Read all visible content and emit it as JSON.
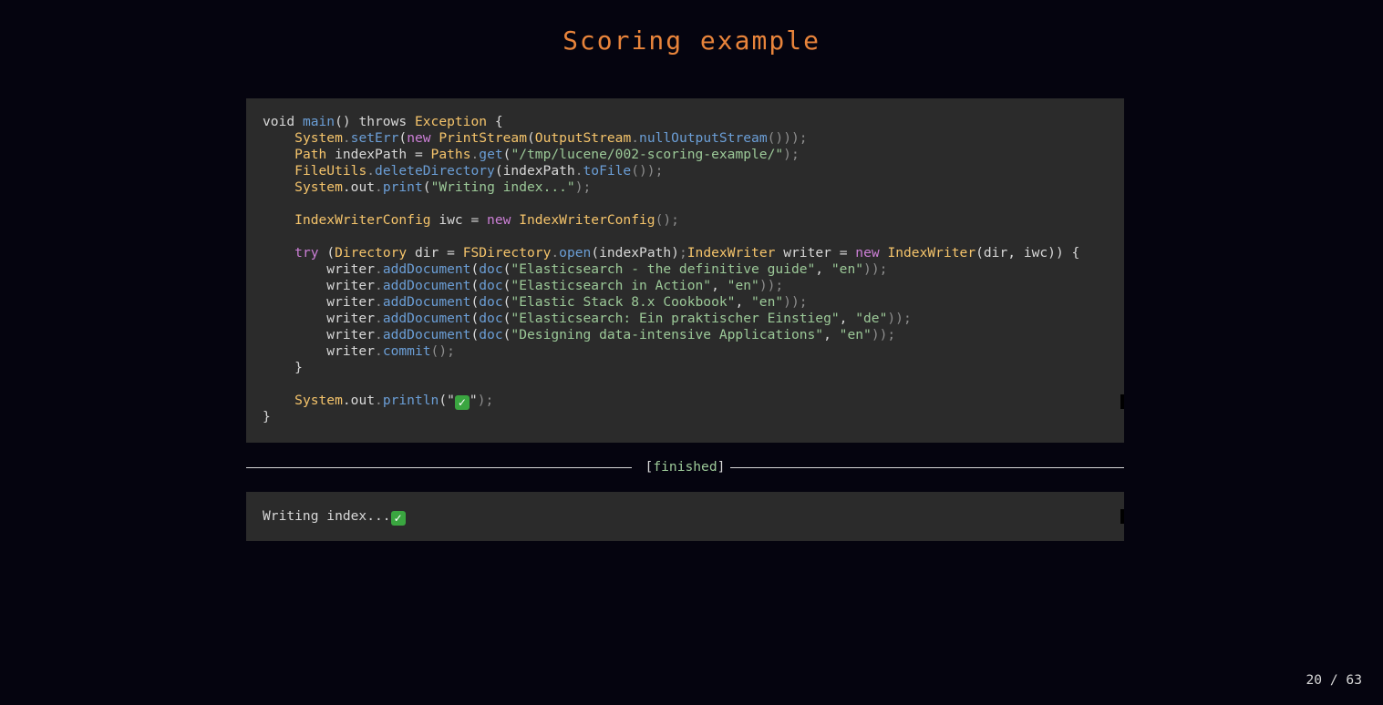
{
  "slide": {
    "title": "Scoring example",
    "page_indicator": "20 / 63"
  },
  "code": {
    "lines": [
      [
        {
          "t": "void ",
          "c": "kw"
        },
        {
          "t": "main",
          "c": "fn"
        },
        {
          "t": "() ",
          "c": "tx"
        },
        {
          "t": "throws ",
          "c": "kw"
        },
        {
          "t": "Exception",
          "c": "ty"
        },
        {
          "t": " {",
          "c": "tx"
        }
      ],
      [
        {
          "t": "    ",
          "c": "tx"
        },
        {
          "t": "System",
          "c": "ty"
        },
        {
          "t": ".",
          "c": "pu"
        },
        {
          "t": "setErr",
          "c": "fn"
        },
        {
          "t": "(",
          "c": "tx"
        },
        {
          "t": "new ",
          "c": "pk"
        },
        {
          "t": "PrintStream",
          "c": "ty"
        },
        {
          "t": "(",
          "c": "tx"
        },
        {
          "t": "OutputStream",
          "c": "ty"
        },
        {
          "t": ".",
          "c": "pu"
        },
        {
          "t": "nullOutputStream",
          "c": "fn"
        },
        {
          "t": "()));",
          "c": "pu"
        }
      ],
      [
        {
          "t": "    ",
          "c": "tx"
        },
        {
          "t": "Path",
          "c": "ty"
        },
        {
          "t": " indexPath = ",
          "c": "tx"
        },
        {
          "t": "Paths",
          "c": "ty"
        },
        {
          "t": ".",
          "c": "pu"
        },
        {
          "t": "get",
          "c": "fn"
        },
        {
          "t": "(",
          "c": "tx"
        },
        {
          "t": "\"/tmp/lucene/002-scoring-example/\"",
          "c": "st"
        },
        {
          "t": ");",
          "c": "pu"
        }
      ],
      [
        {
          "t": "    ",
          "c": "tx"
        },
        {
          "t": "FileUtils",
          "c": "ty"
        },
        {
          "t": ".",
          "c": "pu"
        },
        {
          "t": "deleteDirectory",
          "c": "fn"
        },
        {
          "t": "(indexPath",
          "c": "tx"
        },
        {
          "t": ".",
          "c": "pu"
        },
        {
          "t": "toFile",
          "c": "fn"
        },
        {
          "t": "());",
          "c": "pu"
        }
      ],
      [
        {
          "t": "    ",
          "c": "tx"
        },
        {
          "t": "System",
          "c": "ty"
        },
        {
          "t": ".out",
          "c": "tx"
        },
        {
          "t": ".",
          "c": "pu"
        },
        {
          "t": "print",
          "c": "fn"
        },
        {
          "t": "(",
          "c": "tx"
        },
        {
          "t": "\"Writing index...\"",
          "c": "st"
        },
        {
          "t": ");",
          "c": "pu"
        }
      ],
      [],
      [
        {
          "t": "    ",
          "c": "tx"
        },
        {
          "t": "IndexWriterConfig",
          "c": "ty"
        },
        {
          "t": " iwc = ",
          "c": "tx"
        },
        {
          "t": "new ",
          "c": "pk"
        },
        {
          "t": "IndexWriterConfig",
          "c": "ty"
        },
        {
          "t": "();",
          "c": "pu"
        }
      ],
      [],
      [
        {
          "t": "    ",
          "c": "tx"
        },
        {
          "t": "try ",
          "c": "pk"
        },
        {
          "t": "(",
          "c": "tx"
        },
        {
          "t": "Directory",
          "c": "ty"
        },
        {
          "t": " dir = ",
          "c": "tx"
        },
        {
          "t": "FSDirectory",
          "c": "ty"
        },
        {
          "t": ".",
          "c": "pu"
        },
        {
          "t": "open",
          "c": "fn"
        },
        {
          "t": "(indexPath)",
          "c": "tx"
        },
        {
          "t": ";",
          "c": "pu"
        },
        {
          "t": "IndexWriter",
          "c": "ty"
        },
        {
          "t": " writer = ",
          "c": "tx"
        },
        {
          "t": "new ",
          "c": "pk"
        },
        {
          "t": "IndexWriter",
          "c": "ty"
        },
        {
          "t": "(dir, iwc)) {",
          "c": "tx"
        }
      ],
      [
        {
          "t": "        writer",
          "c": "tx"
        },
        {
          "t": ".",
          "c": "pu"
        },
        {
          "t": "addDocument",
          "c": "fn"
        },
        {
          "t": "(",
          "c": "tx"
        },
        {
          "t": "doc",
          "c": "fn"
        },
        {
          "t": "(",
          "c": "tx"
        },
        {
          "t": "\"Elasticsearch - the definitive guide\"",
          "c": "st"
        },
        {
          "t": ", ",
          "c": "tx"
        },
        {
          "t": "\"en\"",
          "c": "st"
        },
        {
          "t": "));",
          "c": "pu"
        }
      ],
      [
        {
          "t": "        writer",
          "c": "tx"
        },
        {
          "t": ".",
          "c": "pu"
        },
        {
          "t": "addDocument",
          "c": "fn"
        },
        {
          "t": "(",
          "c": "tx"
        },
        {
          "t": "doc",
          "c": "fn"
        },
        {
          "t": "(",
          "c": "tx"
        },
        {
          "t": "\"Elasticsearch in Action\"",
          "c": "st"
        },
        {
          "t": ", ",
          "c": "tx"
        },
        {
          "t": "\"en\"",
          "c": "st"
        },
        {
          "t": "));",
          "c": "pu"
        }
      ],
      [
        {
          "t": "        writer",
          "c": "tx"
        },
        {
          "t": ".",
          "c": "pu"
        },
        {
          "t": "addDocument",
          "c": "fn"
        },
        {
          "t": "(",
          "c": "tx"
        },
        {
          "t": "doc",
          "c": "fn"
        },
        {
          "t": "(",
          "c": "tx"
        },
        {
          "t": "\"Elastic Stack 8.x Cookbook\"",
          "c": "st"
        },
        {
          "t": ", ",
          "c": "tx"
        },
        {
          "t": "\"en\"",
          "c": "st"
        },
        {
          "t": "));",
          "c": "pu"
        }
      ],
      [
        {
          "t": "        writer",
          "c": "tx"
        },
        {
          "t": ".",
          "c": "pu"
        },
        {
          "t": "addDocument",
          "c": "fn"
        },
        {
          "t": "(",
          "c": "tx"
        },
        {
          "t": "doc",
          "c": "fn"
        },
        {
          "t": "(",
          "c": "tx"
        },
        {
          "t": "\"Elasticsearch: Ein praktischer Einstieg\"",
          "c": "st"
        },
        {
          "t": ", ",
          "c": "tx"
        },
        {
          "t": "\"de\"",
          "c": "st"
        },
        {
          "t": "));",
          "c": "pu"
        }
      ],
      [
        {
          "t": "        writer",
          "c": "tx"
        },
        {
          "t": ".",
          "c": "pu"
        },
        {
          "t": "addDocument",
          "c": "fn"
        },
        {
          "t": "(",
          "c": "tx"
        },
        {
          "t": "doc",
          "c": "fn"
        },
        {
          "t": "(",
          "c": "tx"
        },
        {
          "t": "\"Designing data-intensive Applications\"",
          "c": "st"
        },
        {
          "t": ", ",
          "c": "tx"
        },
        {
          "t": "\"en\"",
          "c": "st"
        },
        {
          "t": "));",
          "c": "pu"
        }
      ],
      [
        {
          "t": "        writer",
          "c": "tx"
        },
        {
          "t": ".",
          "c": "pu"
        },
        {
          "t": "commit",
          "c": "fn"
        },
        {
          "t": "();",
          "c": "pu"
        }
      ],
      [
        {
          "t": "    }",
          "c": "tx"
        }
      ],
      [],
      [
        {
          "t": "    ",
          "c": "tx"
        },
        {
          "t": "System",
          "c": "ty"
        },
        {
          "t": ".out",
          "c": "tx"
        },
        {
          "t": ".",
          "c": "pu"
        },
        {
          "t": "println",
          "c": "fn"
        },
        {
          "t": "(\"",
          "c": "tx"
        },
        {
          "t": "✓",
          "c": "check"
        },
        {
          "t": "\"",
          "c": "tx"
        },
        {
          "t": ");",
          "c": "pu"
        }
      ],
      [
        {
          "t": "}",
          "c": "tx"
        }
      ]
    ]
  },
  "execution": {
    "status_open": "[",
    "status": "finished",
    "status_close": "]"
  },
  "output": {
    "text": "Writing index...",
    "success_mark": "✓"
  },
  "colors": {
    "background": "#05040f",
    "title": "#e8843b",
    "code_background": "#2b2b2b",
    "type": "#f5c46b",
    "function": "#6b9ed6",
    "string": "#9cc998",
    "keyword": "#cc7fd6",
    "success": "#3aa640"
  },
  "icons": {
    "checkmark": "white-check-mark-icon"
  }
}
